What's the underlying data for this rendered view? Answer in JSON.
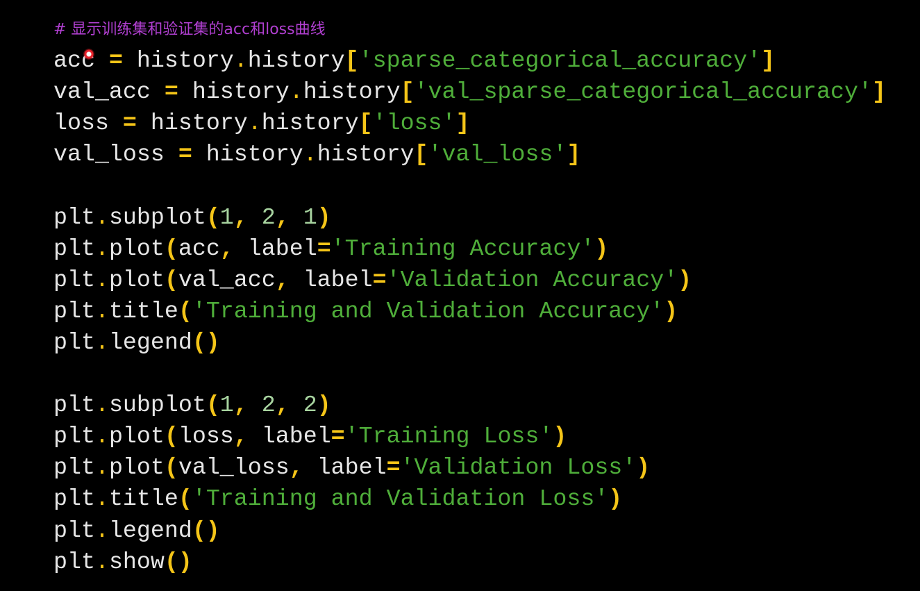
{
  "editor": {
    "background": "#000000",
    "colors": {
      "identifier": "#e6e6e6",
      "operator": "#f5c518",
      "string": "#4fae3a",
      "number": "#a8d4a0",
      "comment": "#b03fd0"
    },
    "lines": [
      {
        "kind": "comment",
        "tokens": [
          {
            "t": "comm",
            "v": "# 显示训练集和验证集的acc和loss曲线"
          }
        ]
      },
      {
        "kind": "code",
        "tokens": [
          {
            "t": "id",
            "v": "acc "
          },
          {
            "t": "op",
            "v": "="
          },
          {
            "t": "id",
            "v": " history"
          },
          {
            "t": "dot",
            "v": "."
          },
          {
            "t": "id",
            "v": "history"
          },
          {
            "t": "br",
            "v": "["
          },
          {
            "t": "str",
            "v": "'sparse_categorical_accuracy'"
          },
          {
            "t": "br",
            "v": "]"
          }
        ]
      },
      {
        "kind": "code",
        "tokens": [
          {
            "t": "id",
            "v": "val_acc "
          },
          {
            "t": "op",
            "v": "="
          },
          {
            "t": "id",
            "v": " history"
          },
          {
            "t": "dot",
            "v": "."
          },
          {
            "t": "id",
            "v": "history"
          },
          {
            "t": "br",
            "v": "["
          },
          {
            "t": "str",
            "v": "'val_sparse_categorical_accuracy'"
          },
          {
            "t": "br",
            "v": "]"
          }
        ]
      },
      {
        "kind": "code",
        "tokens": [
          {
            "t": "id",
            "v": "loss "
          },
          {
            "t": "op",
            "v": "="
          },
          {
            "t": "id",
            "v": " history"
          },
          {
            "t": "dot",
            "v": "."
          },
          {
            "t": "id",
            "v": "history"
          },
          {
            "t": "br",
            "v": "["
          },
          {
            "t": "str",
            "v": "'loss'"
          },
          {
            "t": "br",
            "v": "]"
          }
        ]
      },
      {
        "kind": "code",
        "tokens": [
          {
            "t": "id",
            "v": "val_loss "
          },
          {
            "t": "op",
            "v": "="
          },
          {
            "t": "id",
            "v": " history"
          },
          {
            "t": "dot",
            "v": "."
          },
          {
            "t": "id",
            "v": "history"
          },
          {
            "t": "br",
            "v": "["
          },
          {
            "t": "str",
            "v": "'val_loss'"
          },
          {
            "t": "br",
            "v": "]"
          }
        ]
      },
      {
        "kind": "blank",
        "tokens": []
      },
      {
        "kind": "code",
        "tokens": [
          {
            "t": "id",
            "v": "plt"
          },
          {
            "t": "dot",
            "v": "."
          },
          {
            "t": "id",
            "v": "subplot"
          },
          {
            "t": "br",
            "v": "("
          },
          {
            "t": "num",
            "v": "1"
          },
          {
            "t": "op",
            "v": ","
          },
          {
            "t": "id",
            "v": " "
          },
          {
            "t": "num",
            "v": "2"
          },
          {
            "t": "op",
            "v": ","
          },
          {
            "t": "id",
            "v": " "
          },
          {
            "t": "num",
            "v": "1"
          },
          {
            "t": "br",
            "v": ")"
          }
        ]
      },
      {
        "kind": "code",
        "tokens": [
          {
            "t": "id",
            "v": "plt"
          },
          {
            "t": "dot",
            "v": "."
          },
          {
            "t": "id",
            "v": "plot"
          },
          {
            "t": "br",
            "v": "("
          },
          {
            "t": "id",
            "v": "acc"
          },
          {
            "t": "op",
            "v": ","
          },
          {
            "t": "id",
            "v": " label"
          },
          {
            "t": "op",
            "v": "="
          },
          {
            "t": "str",
            "v": "'Training Accuracy'"
          },
          {
            "t": "br",
            "v": ")"
          }
        ]
      },
      {
        "kind": "code",
        "tokens": [
          {
            "t": "id",
            "v": "plt"
          },
          {
            "t": "dot",
            "v": "."
          },
          {
            "t": "id",
            "v": "plot"
          },
          {
            "t": "br",
            "v": "("
          },
          {
            "t": "id",
            "v": "val_acc"
          },
          {
            "t": "op",
            "v": ","
          },
          {
            "t": "id",
            "v": " label"
          },
          {
            "t": "op",
            "v": "="
          },
          {
            "t": "str",
            "v": "'Validation Accuracy'"
          },
          {
            "t": "br",
            "v": ")"
          }
        ]
      },
      {
        "kind": "code",
        "tokens": [
          {
            "t": "id",
            "v": "plt"
          },
          {
            "t": "dot",
            "v": "."
          },
          {
            "t": "id",
            "v": "title"
          },
          {
            "t": "br",
            "v": "("
          },
          {
            "t": "str",
            "v": "'Training and Validation Accuracy'"
          },
          {
            "t": "br",
            "v": ")"
          }
        ]
      },
      {
        "kind": "code",
        "tokens": [
          {
            "t": "id",
            "v": "plt"
          },
          {
            "t": "dot",
            "v": "."
          },
          {
            "t": "id",
            "v": "legend"
          },
          {
            "t": "br",
            "v": "()"
          }
        ]
      },
      {
        "kind": "blank",
        "tokens": []
      },
      {
        "kind": "code",
        "tokens": [
          {
            "t": "id",
            "v": "plt"
          },
          {
            "t": "dot",
            "v": "."
          },
          {
            "t": "id",
            "v": "subplot"
          },
          {
            "t": "br",
            "v": "("
          },
          {
            "t": "num",
            "v": "1"
          },
          {
            "t": "op",
            "v": ","
          },
          {
            "t": "id",
            "v": " "
          },
          {
            "t": "num",
            "v": "2"
          },
          {
            "t": "op",
            "v": ","
          },
          {
            "t": "id",
            "v": " "
          },
          {
            "t": "num",
            "v": "2"
          },
          {
            "t": "br",
            "v": ")"
          }
        ]
      },
      {
        "kind": "code",
        "tokens": [
          {
            "t": "id",
            "v": "plt"
          },
          {
            "t": "dot",
            "v": "."
          },
          {
            "t": "id",
            "v": "plot"
          },
          {
            "t": "br",
            "v": "("
          },
          {
            "t": "id",
            "v": "loss"
          },
          {
            "t": "op",
            "v": ","
          },
          {
            "t": "id",
            "v": " label"
          },
          {
            "t": "op",
            "v": "="
          },
          {
            "t": "str",
            "v": "'Training Loss'"
          },
          {
            "t": "br",
            "v": ")"
          }
        ]
      },
      {
        "kind": "code",
        "tokens": [
          {
            "t": "id",
            "v": "plt"
          },
          {
            "t": "dot",
            "v": "."
          },
          {
            "t": "id",
            "v": "plot"
          },
          {
            "t": "br",
            "v": "("
          },
          {
            "t": "id",
            "v": "val_loss"
          },
          {
            "t": "op",
            "v": ","
          },
          {
            "t": "id",
            "v": " label"
          },
          {
            "t": "op",
            "v": "="
          },
          {
            "t": "str",
            "v": "'Validation Loss'"
          },
          {
            "t": "br",
            "v": ")"
          }
        ]
      },
      {
        "kind": "code",
        "tokens": [
          {
            "t": "id",
            "v": "plt"
          },
          {
            "t": "dot",
            "v": "."
          },
          {
            "t": "id",
            "v": "title"
          },
          {
            "t": "br",
            "v": "("
          },
          {
            "t": "str",
            "v": "'Training and Validation Loss'"
          },
          {
            "t": "br",
            "v": ")"
          }
        ]
      },
      {
        "kind": "code",
        "tokens": [
          {
            "t": "id",
            "v": "plt"
          },
          {
            "t": "dot",
            "v": "."
          },
          {
            "t": "id",
            "v": "legend"
          },
          {
            "t": "br",
            "v": "()"
          }
        ]
      },
      {
        "kind": "code",
        "tokens": [
          {
            "t": "id",
            "v": "plt"
          },
          {
            "t": "dot",
            "v": "."
          },
          {
            "t": "id",
            "v": "show"
          },
          {
            "t": "br",
            "v": "()"
          }
        ]
      }
    ]
  },
  "cursor": {
    "icon": "mouse-cursor-dot-icon"
  }
}
